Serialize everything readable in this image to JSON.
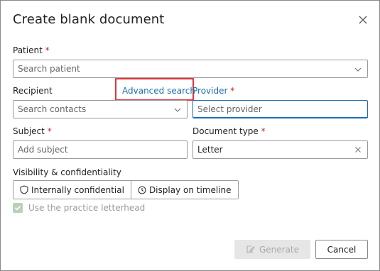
{
  "dialog": {
    "title": "Create blank document",
    "close_icon": "close-icon"
  },
  "patient": {
    "label": "Patient",
    "required_mark": "*",
    "placeholder": "Search patient"
  },
  "recipient": {
    "label": "Recipient",
    "placeholder": "Search contacts",
    "advanced_search_label": "Advanced search"
  },
  "provider": {
    "label": "Provider",
    "required_mark": "*",
    "placeholder": "Select provider"
  },
  "subject": {
    "label": "Subject",
    "required_mark": "*",
    "placeholder": "Add subject"
  },
  "document_type": {
    "label": "Document type",
    "required_mark": "*",
    "value": "Letter"
  },
  "visibility": {
    "label": "Visibility & confidentiality",
    "options": [
      {
        "label": "Internally confidential",
        "icon": "shield-icon"
      },
      {
        "label": "Display on timeline",
        "icon": "clock-icon"
      }
    ]
  },
  "letterhead": {
    "label": "Use the practice letterhead",
    "checked": true
  },
  "footer": {
    "generate_label": "Generate",
    "cancel_label": "Cancel"
  },
  "colors": {
    "accent": "#1a6fb0",
    "required": "#c0262d",
    "highlight": "#e0363b"
  }
}
